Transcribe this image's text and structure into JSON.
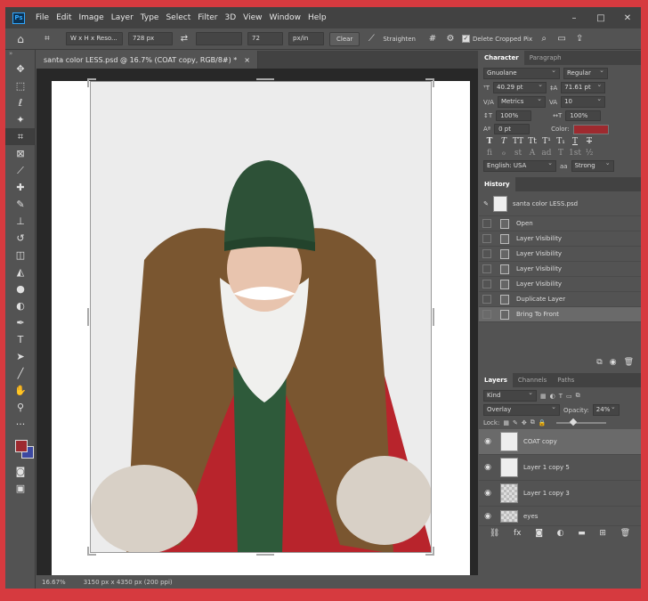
{
  "menubar": {
    "logo": "Ps",
    "items": [
      "File",
      "Edit",
      "Image",
      "Layer",
      "Type",
      "Select",
      "Filter",
      "3D",
      "View",
      "Window",
      "Help"
    ],
    "controls": [
      "–",
      "□",
      "✕"
    ]
  },
  "options": {
    "preset": "W x H x Reso...",
    "width": "728 px",
    "height": "",
    "resolution": "72",
    "unit": "px/in",
    "clear": "Clear",
    "straighten": "Straighten",
    "delete_cropped": "Delete Cropped Pix"
  },
  "document": {
    "tab_title": "santa color LESS.psd @ 16.7% (COAT copy, RGB/8#) *",
    "tab_close": "×",
    "zoom": "16.67%",
    "doc_info": "3150 px x 4350 px (200 ppi)"
  },
  "character": {
    "tabs": [
      "Character",
      "Paragraph"
    ],
    "font_family": "Gnuolane",
    "font_style": "Regular",
    "font_size": "40.29 pt",
    "leading": "71.61 pt",
    "kerning": "Metrics",
    "tracking": "10",
    "vertical_scale": "100%",
    "horizontal_scale": "100%",
    "baseline_shift": "0 pt",
    "color_label": "Color:",
    "color": "#9e2a2f",
    "style_buttons": [
      "T",
      "T",
      "TT",
      "Tt",
      "T¹",
      "T₁",
      "T",
      "T"
    ],
    "opentype_buttons": [
      "fi",
      "ℴ",
      "st",
      "A",
      "ad",
      "T",
      "1st",
      "½"
    ],
    "language": "English: USA",
    "antialias_icon": "aa",
    "antialias": "Strong"
  },
  "history": {
    "title": "History",
    "snapshot": "santa color LESS.psd",
    "items": [
      "Open",
      "Layer Visibility",
      "Layer Visibility",
      "Layer Visibility",
      "Layer Visibility",
      "Duplicate Layer",
      "Bring To Front"
    ]
  },
  "layers": {
    "tabs": [
      "Layers",
      "Channels",
      "Paths"
    ],
    "filter": "Kind",
    "blend_mode": "Overlay",
    "opacity_label": "Opacity:",
    "opacity": "24%",
    "lock_label": "Lock:",
    "items": [
      {
        "name": "COAT copy",
        "selected": true
      },
      {
        "name": "Layer 1 copy 5",
        "selected": false
      },
      {
        "name": "Layer 1 copy 3",
        "selected": false
      },
      {
        "name": "eyes",
        "selected": false
      }
    ]
  }
}
